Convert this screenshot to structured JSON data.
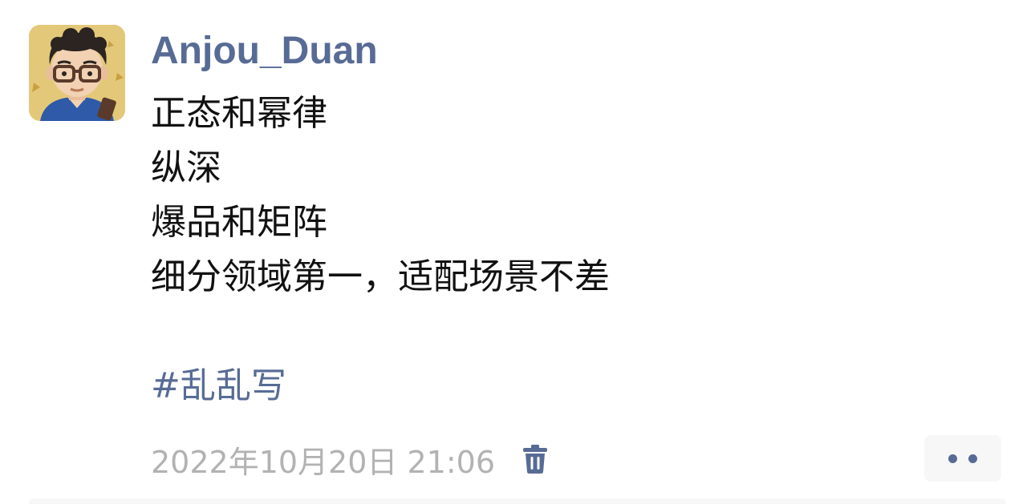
{
  "post": {
    "author": "Anjou_Duan",
    "lines": [
      "正态和幂律",
      "纵深",
      "爆品和矩阵",
      "细分领域第一，适配场景不差"
    ],
    "hashtag": "#乱乱写",
    "timestamp": "2022年10月20日 21:06"
  },
  "icons": {
    "delete": "trash-icon",
    "more": "more-dots-icon"
  },
  "colors": {
    "link": "#576b95",
    "text": "#111111",
    "meta": "#b2b2b2",
    "button_bg": "#f7f7f7"
  }
}
